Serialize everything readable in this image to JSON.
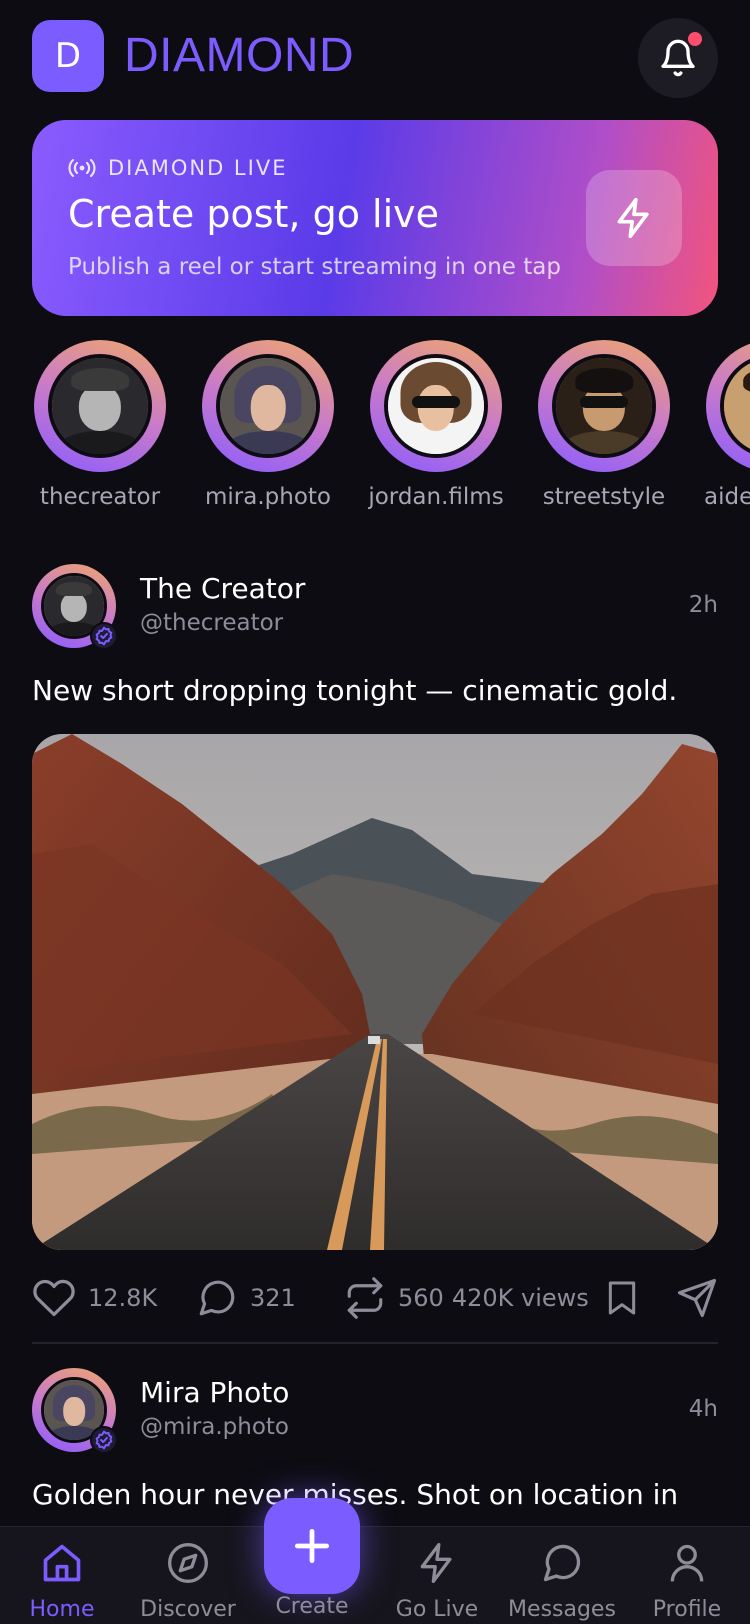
{
  "header": {
    "logo_letter": "D",
    "brand": "DIAMOND"
  },
  "banner": {
    "tag": "DIAMOND LIVE",
    "title": "Create post, go live",
    "subtitle": "Publish a reel or start streaming in one tap"
  },
  "stories": [
    {
      "name": "thecreator"
    },
    {
      "name": "mira.photo"
    },
    {
      "name": "jordan.films"
    },
    {
      "name": "streetstyle"
    },
    {
      "name": "aide"
    }
  ],
  "posts": [
    {
      "name": "The Creator",
      "handle": "@thecreator",
      "time": "2h",
      "text": "New short dropping tonight — cinematic gold.",
      "likes": "12.8K",
      "comments": "321",
      "reposts": "560",
      "views": "420K views"
    },
    {
      "name": "Mira Photo",
      "handle": "@mira.photo",
      "time": "4h",
      "text": "Golden hour never misses. Shot on location in"
    }
  ],
  "nav": {
    "home": "Home",
    "discover": "Discover",
    "create": "Create",
    "golive": "Go Live",
    "messages": "Messages",
    "profile": "Profile"
  },
  "colors": {
    "accent": "#7b5cff",
    "background": "#0d0c12",
    "notification_dot": "#ff4d6d",
    "banner_gradient_end": "#f2547d"
  },
  "icons": [
    "bell-icon",
    "broadcast-icon",
    "lightning-icon",
    "verified-icon",
    "heart-icon",
    "comment-icon",
    "repost-icon",
    "bookmark-icon",
    "send-icon",
    "home-icon",
    "compass-icon",
    "plus-icon",
    "user-icon"
  ]
}
